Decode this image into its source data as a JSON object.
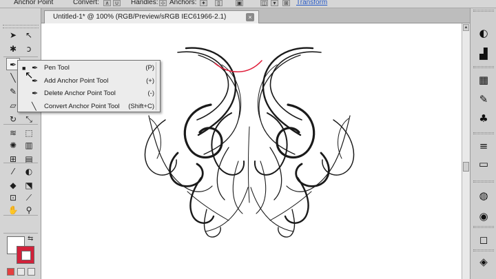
{
  "control_bar": {
    "anchor_point_label": "Anchor Point",
    "convert_label": "Convert:",
    "handles_label": "Handles:",
    "anchors_label": "Anchors:",
    "transform_link": "Transform"
  },
  "document": {
    "tab_title": "Untitled-1* @ 100% (RGB/Preview/sRGB IEC61966-2.1)",
    "close_glyph": "×"
  },
  "tools": {
    "items": [
      {
        "name": "selection-tool-icon",
        "glyph": "➤"
      },
      {
        "name": "direct-selection-tool-icon",
        "glyph": "↖"
      },
      {
        "name": "magic-wand-tool-icon",
        "glyph": "✱"
      },
      {
        "name": "lasso-tool-icon",
        "glyph": "ↄ"
      },
      {
        "name": "pen-tool-icon",
        "glyph": "✒"
      },
      {
        "name": "type-tool-icon",
        "glyph": "T"
      },
      {
        "name": "line-tool-icon",
        "glyph": "╲"
      },
      {
        "name": "rectangle-tool-icon",
        "glyph": "▭"
      },
      {
        "name": "paintbrush-tool-icon",
        "glyph": "✎"
      },
      {
        "name": "pencil-tool-icon",
        "glyph": "✏"
      },
      {
        "name": "blob-brush-tool-icon",
        "glyph": "▱"
      },
      {
        "name": "eraser-tool-icon",
        "glyph": "⌫"
      },
      {
        "name": "rotate-tool-icon",
        "glyph": "↻"
      },
      {
        "name": "scale-tool-icon",
        "glyph": "⤡"
      },
      {
        "name": "warp-tool-icon",
        "glyph": "≋"
      },
      {
        "name": "free-transform-tool-icon",
        "glyph": "⬚"
      },
      {
        "name": "symbol-sprayer-tool-icon",
        "glyph": "✺"
      },
      {
        "name": "column-graph-tool-icon",
        "glyph": "▥"
      },
      {
        "name": "mesh-tool-icon",
        "glyph": "⊞"
      },
      {
        "name": "gradient-tool-icon",
        "glyph": "▤"
      },
      {
        "name": "eyedropper-tool-icon",
        "glyph": "⁄"
      },
      {
        "name": "blend-tool-icon",
        "glyph": "◐"
      },
      {
        "name": "live-paint-bucket-tool-icon",
        "glyph": "◆"
      },
      {
        "name": "live-paint-selection-tool-icon",
        "glyph": "⬔"
      },
      {
        "name": "artboard-tool-icon",
        "glyph": "⊡"
      },
      {
        "name": "slice-tool-icon",
        "glyph": "⟋"
      },
      {
        "name": "hand-tool-icon",
        "glyph": "✋"
      },
      {
        "name": "zoom-tool-icon",
        "glyph": "⚲"
      }
    ]
  },
  "flyout": {
    "items": [
      {
        "bullet": "■",
        "icon": "✒",
        "label": "Pen Tool",
        "key": "(P)"
      },
      {
        "bullet": "",
        "icon": "✒",
        "label": "Add Anchor Point Tool",
        "key": "(+)"
      },
      {
        "bullet": "",
        "icon": "✒",
        "label": "Delete Anchor Point Tool",
        "key": "(-)"
      },
      {
        "bullet": "",
        "icon": "╲",
        "label": "Convert Anchor Point Tool",
        "key": "(Shift+C)"
      }
    ]
  },
  "dock": {
    "items": [
      {
        "name": "color-panel-icon",
        "glyph": "◐"
      },
      {
        "name": "color-guide-panel-icon",
        "glyph": "▟"
      },
      {
        "name": "swatches-panel-icon",
        "glyph": "▦"
      },
      {
        "name": "brushes-panel-icon",
        "glyph": "✎"
      },
      {
        "name": "symbols-panel-icon",
        "glyph": "♣"
      },
      {
        "name": "stroke-panel-icon",
        "glyph": "≡"
      },
      {
        "name": "gradient-panel-icon",
        "glyph": "▭"
      },
      {
        "name": "transparency-panel-icon",
        "glyph": "◍"
      },
      {
        "name": "appearance-panel-icon",
        "glyph": "◉"
      },
      {
        "name": "graphic-styles-panel-icon",
        "glyph": "◻"
      },
      {
        "name": "layers-panel-icon",
        "glyph": "◈"
      }
    ]
  },
  "colors": {
    "fill": "#ffffff",
    "stroke": "#d2213a",
    "selected_path": "#e0203c"
  }
}
